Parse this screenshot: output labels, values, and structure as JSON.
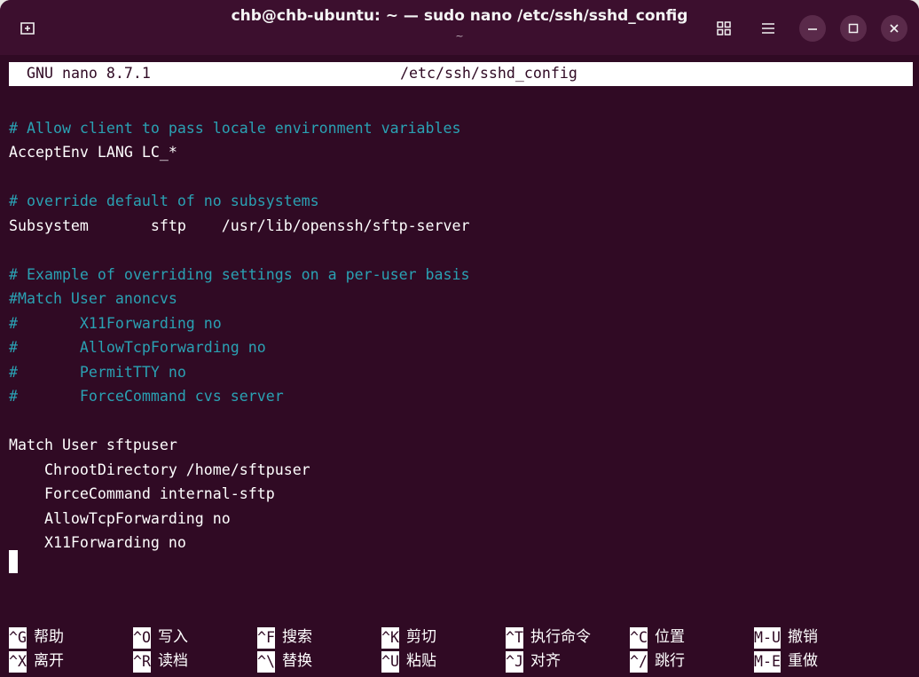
{
  "titlebar": {
    "title": "chb@chb-ubuntu: ~ — sudo nano /etc/ssh/sshd_config",
    "subtitle": "~",
    "new_tab_glyph": "⊞",
    "grid_glyph": "▦",
    "menu_glyph": "☰",
    "minimize_glyph": "—",
    "maximize_glyph": "☐",
    "close_glyph": "✕"
  },
  "nano": {
    "version": "GNU nano 8.7.1",
    "filename": "/etc/ssh/sshd_config"
  },
  "lines": [
    {
      "text": "",
      "comment": false
    },
    {
      "text": "# Allow client to pass locale environment variables",
      "comment": true
    },
    {
      "text": "AcceptEnv LANG LC_*",
      "comment": false
    },
    {
      "text": "",
      "comment": false
    },
    {
      "text": "# override default of no subsystems",
      "comment": true
    },
    {
      "text": "Subsystem       sftp    /usr/lib/openssh/sftp-server",
      "comment": false
    },
    {
      "text": "",
      "comment": false
    },
    {
      "text": "# Example of overriding settings on a per-user basis",
      "comment": true
    },
    {
      "text": "#Match User anoncvs",
      "comment": true
    },
    {
      "text": "#       X11Forwarding no",
      "comment": true
    },
    {
      "text": "#       AllowTcpForwarding no",
      "comment": true
    },
    {
      "text": "#       PermitTTY no",
      "comment": true
    },
    {
      "text": "#       ForceCommand cvs server",
      "comment": true
    },
    {
      "text": "",
      "comment": false
    },
    {
      "text": "Match User sftpuser",
      "comment": false
    },
    {
      "text": "    ChrootDirectory /home/sftpuser",
      "comment": false
    },
    {
      "text": "    ForceCommand internal-sftp",
      "comment": false
    },
    {
      "text": "    AllowTcpForwarding no",
      "comment": false
    },
    {
      "text": "    X11Forwarding no",
      "comment": false
    }
  ],
  "shortcuts": [
    {
      "key": "^G",
      "label": "帮助"
    },
    {
      "key": "^O",
      "label": "写入"
    },
    {
      "key": "^F",
      "label": "搜索"
    },
    {
      "key": "^K",
      "label": "剪切"
    },
    {
      "key": "^T",
      "label": "执行命令"
    },
    {
      "key": "^C",
      "label": "位置"
    },
    {
      "key": "M-U",
      "label": "撤销"
    },
    {
      "key": "^X",
      "label": "离开"
    },
    {
      "key": "^R",
      "label": "读档"
    },
    {
      "key": "^\\",
      "label": "替换"
    },
    {
      "key": "^U",
      "label": "粘贴"
    },
    {
      "key": "^J",
      "label": "对齐"
    },
    {
      "key": "^/",
      "label": "跳行"
    },
    {
      "key": "M-E",
      "label": "重做"
    }
  ],
  "colors": {
    "background": "#300a24",
    "comment": "#2aa1b3",
    "text": "#ffffff"
  }
}
